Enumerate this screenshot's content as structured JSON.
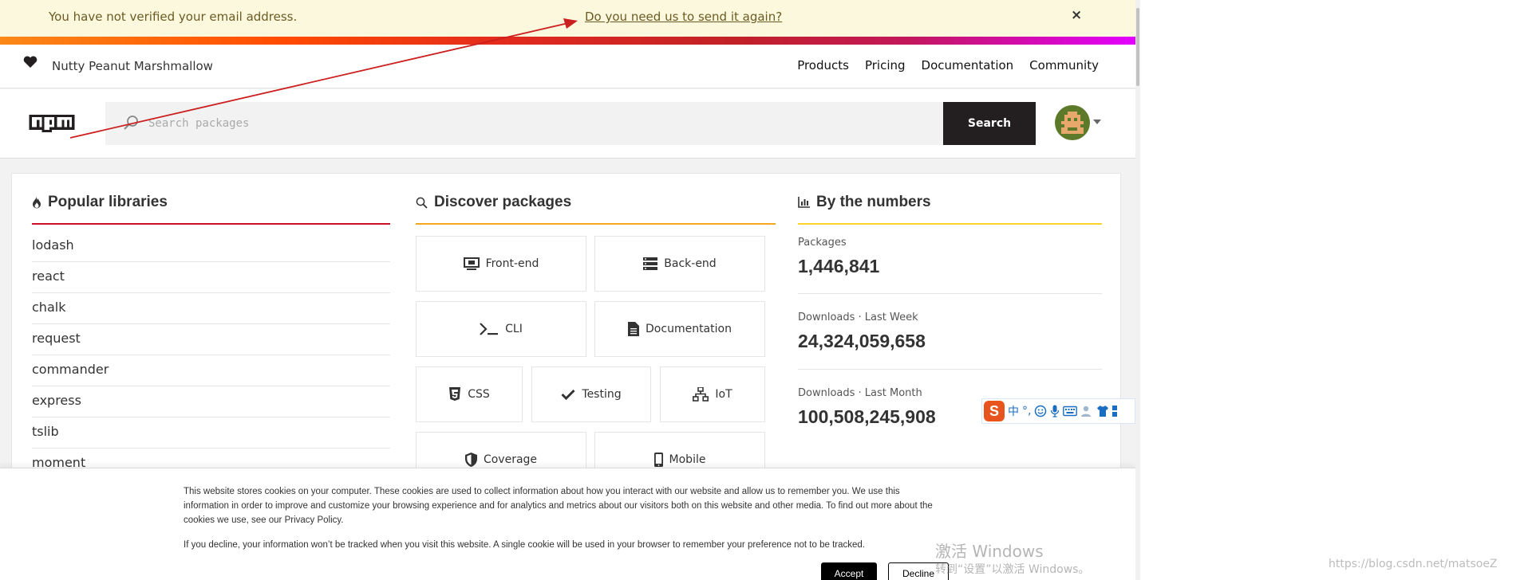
{
  "banner": {
    "message": "You have not verified your email address.",
    "resend_link": "Do you need us to send it again?",
    "close": "×"
  },
  "topnav": {
    "motto": "Nutty Peanut Marshmallow",
    "links": [
      "Products",
      "Pricing",
      "Documentation",
      "Community"
    ]
  },
  "search": {
    "placeholder": "Search packages",
    "button_label": "Search"
  },
  "popular": {
    "title": "Popular libraries",
    "items": [
      "lodash",
      "react",
      "chalk",
      "request",
      "commander",
      "express",
      "tslib",
      "moment"
    ]
  },
  "discover": {
    "title": "Discover packages",
    "tiles": [
      {
        "label": "Front-end",
        "icon": "monitor-icon"
      },
      {
        "label": "Back-end",
        "icon": "server-icon"
      },
      {
        "label": "CLI",
        "icon": "terminal-icon"
      },
      {
        "label": "Documentation",
        "icon": "document-icon"
      },
      {
        "label": "CSS",
        "icon": "css3-icon"
      },
      {
        "label": "Testing",
        "icon": "checkmark-icon"
      },
      {
        "label": "IoT",
        "icon": "network-icon"
      },
      {
        "label": "Coverage",
        "icon": "shield-icon"
      },
      {
        "label": "Mobile",
        "icon": "phone-icon"
      }
    ]
  },
  "numbers": {
    "title": "By the numbers",
    "stats": [
      {
        "label": "Packages",
        "value": "1,446,841"
      },
      {
        "label": "Downloads · Last Week",
        "value": "24,324,059,658"
      },
      {
        "label": "Downloads · Last Month",
        "value": "100,508,245,908"
      }
    ]
  },
  "cookie": {
    "text1": "This website stores cookies on your computer. These cookies are used to collect information about how you interact with our website and allow us to remember you. We use this information in order to improve and customize your browsing experience and for analytics and metrics about our visitors both on this website and other media. To find out more about the cookies we use, see our Privacy Policy.",
    "text2": "If you decline, your information won’t be tracked when you visit this website. A single cookie will be used in your browser to remember your preference not to be tracked.",
    "accept": "Accept",
    "decline": "Decline"
  },
  "ime": {
    "logo": "S",
    "chinese": "中",
    "punct": "°,"
  },
  "watermark": {
    "line1": "激活 Windows",
    "line2": "转到“设置”以激活 Windows。",
    "csdn": "https://blog.csdn.net/matsoeZ"
  },
  "colors": {
    "popular_line": "#cb0f26",
    "discover_line": "#f6a71b",
    "numbers_line": "#ffd428",
    "arrow": "#cc1f1f"
  }
}
